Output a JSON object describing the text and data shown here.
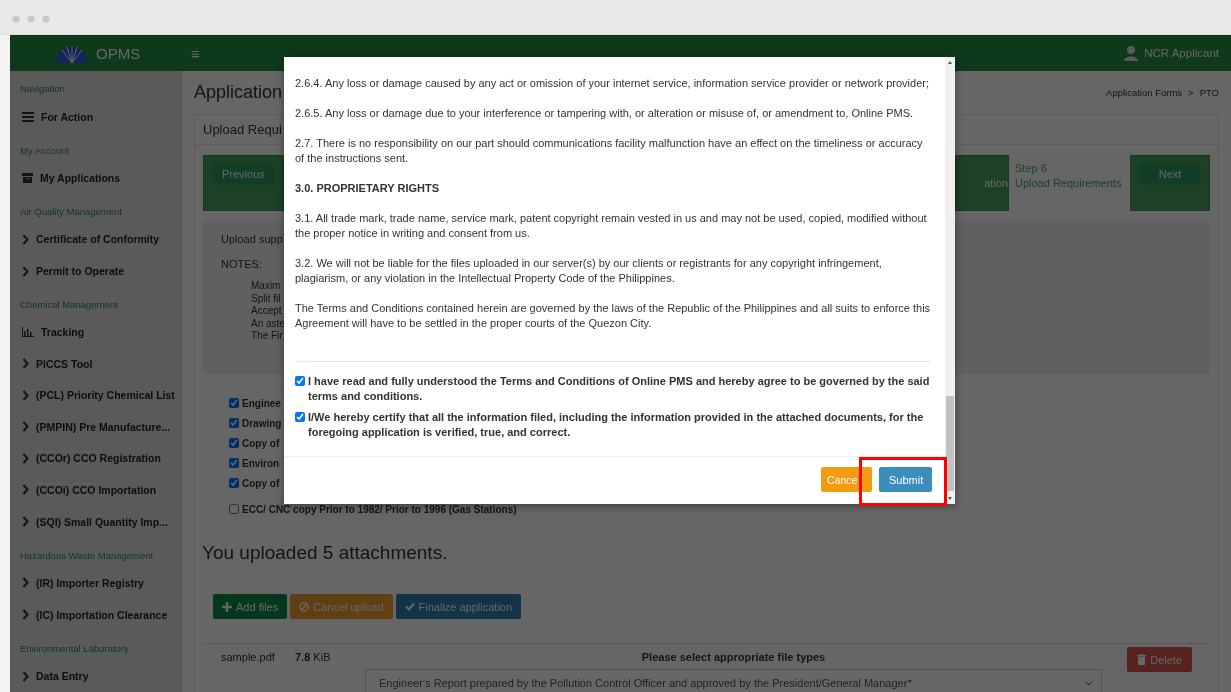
{
  "header": {
    "brand": "OPMS",
    "menu": "≡",
    "user": "NCR Applicant"
  },
  "sidebar": {
    "sections": [
      {
        "title": "Navigation",
        "items": [
          {
            "label": "For Action",
            "kind": "list"
          }
        ]
      },
      {
        "title": "My Account",
        "items": [
          {
            "label": "My Applications",
            "kind": "archive"
          }
        ]
      },
      {
        "title": "Air Quality Management",
        "items": [
          {
            "label": "Certificate of Conformity",
            "kind": "chevron"
          },
          {
            "label": "Permit to Operate",
            "kind": "chevron"
          }
        ]
      },
      {
        "title": "Chemical Management",
        "items": [
          {
            "label": "Tracking",
            "kind": "chart"
          },
          {
            "label": "PICCS Tool",
            "kind": "chevron"
          },
          {
            "label": "(PCL) Priority Chemical List",
            "kind": "chevron"
          },
          {
            "label": "(PMPIN) Pre Manufacture...",
            "kind": "chevron"
          },
          {
            "label": "(CCOr) CCO Registration",
            "kind": "chevron"
          },
          {
            "label": "(CCOi) CCO Importation",
            "kind": "chevron"
          },
          {
            "label": "(SQI) Small Quantity Imp...",
            "kind": "chevron"
          }
        ]
      },
      {
        "title": "Hazardous Waste Management",
        "items": [
          {
            "label": "(IR) Importer Registry",
            "kind": "chevron"
          },
          {
            "label": "(IC) Importation Clearance",
            "kind": "chevron"
          }
        ]
      },
      {
        "title": "Environmental Laboratory",
        "items": [
          {
            "label": "Data Entry",
            "kind": "chevron"
          }
        ]
      }
    ]
  },
  "main": {
    "title": "Application",
    "breadcrumb": [
      "Application Forms",
      "PTO"
    ],
    "breadcrumb_separator": ">",
    "panel_title": "Upload Requi",
    "steps": {
      "previous": "Previous",
      "cut_step": "ation",
      "current_step": "Step 6",
      "current_name": "Upload Requirements",
      "next": "Next"
    },
    "notes": {
      "intro": "Upload supp",
      "heading": "NOTES:",
      "lines": [
        "Maxim",
        "Split fil",
        "Accept",
        "An aste",
        "The Fir"
      ]
    },
    "requirements": [
      {
        "label": "Enginee",
        "checked": true
      },
      {
        "label": "Drawing",
        "checked": true
      },
      {
        "label": "Copy of",
        "checked": true
      },
      {
        "label": "Environ",
        "checked": true
      },
      {
        "label": "Copy of",
        "checked": true
      },
      {
        "label": "ECC/ CNC copy Prior to 1982/ Prior to 1996 (Gas Stations)",
        "checked": false
      }
    ],
    "upload_summary": "You uploaded 5 attachments.",
    "actions": [
      {
        "label": "Add files",
        "kind": "add"
      },
      {
        "label": "Cancel upload",
        "kind": "cancel"
      },
      {
        "label": "Finalize application",
        "kind": "finalize"
      }
    ],
    "files": [
      {
        "name": "sample.pdf",
        "size": "7.8",
        "unit": "KiB",
        "type_label": "Please select appropriate file types",
        "type_value": "Engineer's Report prepared by the Pollution Control Officer and approved by the President/General Manager*",
        "delete": "Delete"
      }
    ]
  },
  "modal": {
    "paragraphs": [
      {
        "kind": "body",
        "text": "2.6.4. Any loss or damage caused by any act or omission of your internet service, information service provider or network provider;"
      },
      {
        "kind": "body",
        "text": "2.6.5. Any loss or damage due to your interference or tampering with, or alteration or misuse of, or amendment to, Online PMS."
      },
      {
        "kind": "body",
        "text": "2.7. There is no responsibility on our part should communications facility malfunction have an effect on the timeliness or accuracy of the instructions sent."
      },
      {
        "kind": "heading",
        "text": "3.0. PROPRIETARY RIGHTS"
      },
      {
        "kind": "body",
        "text": "3.1. All trade mark, trade name, service mark, patent copyright remain vested in us and may not be used, copied, modified without the proper notice in writing and consent from us."
      },
      {
        "kind": "body",
        "text": "3.2. We will not be liable for the files uploaded in our server(s) by our clients or registrants for any copyright infringement, plagiarism, or any violation in the Intellectual Property Code of the Philippines."
      },
      {
        "kind": "body",
        "text": "The Terms and Conditions contained herein are governed by the laws of the Republic of the Philippines and all suits to enforce this Agreement will have to be settled in the proper courts of the Quezon City."
      }
    ],
    "agreements": [
      {
        "text": "I have read and fully understood the Terms and Conditions of Online PMS and hereby agree to be governed by the said terms and conditions.",
        "checked": true
      },
      {
        "text": "I/We hereby certify that all the information filed, including the information provided in the attached documents, for the foregoing application is verified, true, and correct.",
        "checked": true
      }
    ],
    "buttons": [
      {
        "label": "Cance",
        "kind": "cancel"
      },
      {
        "label": "Submit",
        "kind": "submit"
      }
    ]
  }
}
